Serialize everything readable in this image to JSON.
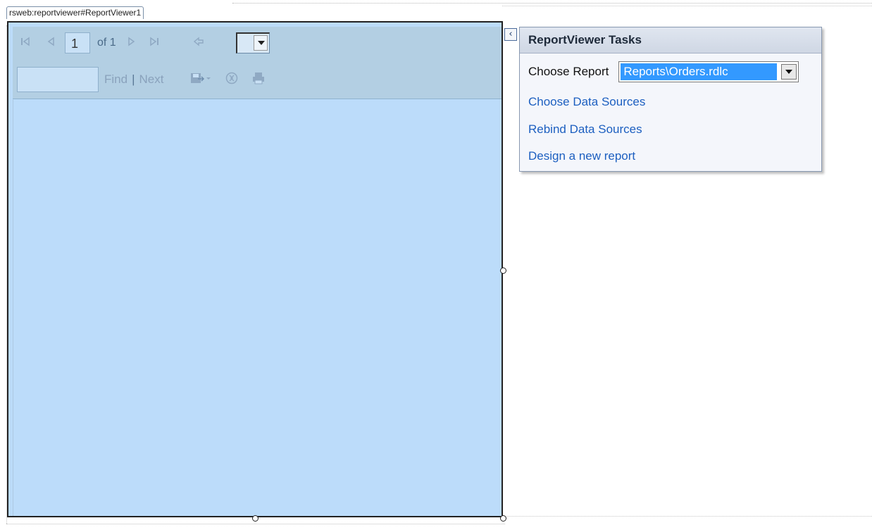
{
  "control_tag": "rsweb:reportviewer#ReportViewer1",
  "viewer": {
    "page_number": "1",
    "page_of": "of 1",
    "find_label": "Find",
    "find_separator": "|",
    "next_label": "Next",
    "find_value": ""
  },
  "tasks": {
    "title": "ReportViewer Tasks",
    "choose_report_label": "Choose Report",
    "choose_report_value": "Reports\\Orders.rdlc",
    "links": [
      "Choose Data Sources",
      "Rebind Data Sources",
      "Design a new report"
    ]
  },
  "colors": {
    "viewer_body": "#bcdcfa",
    "toolbar": "#b3cfe3",
    "link": "#1c5fc0",
    "selection": "#3399ff"
  }
}
